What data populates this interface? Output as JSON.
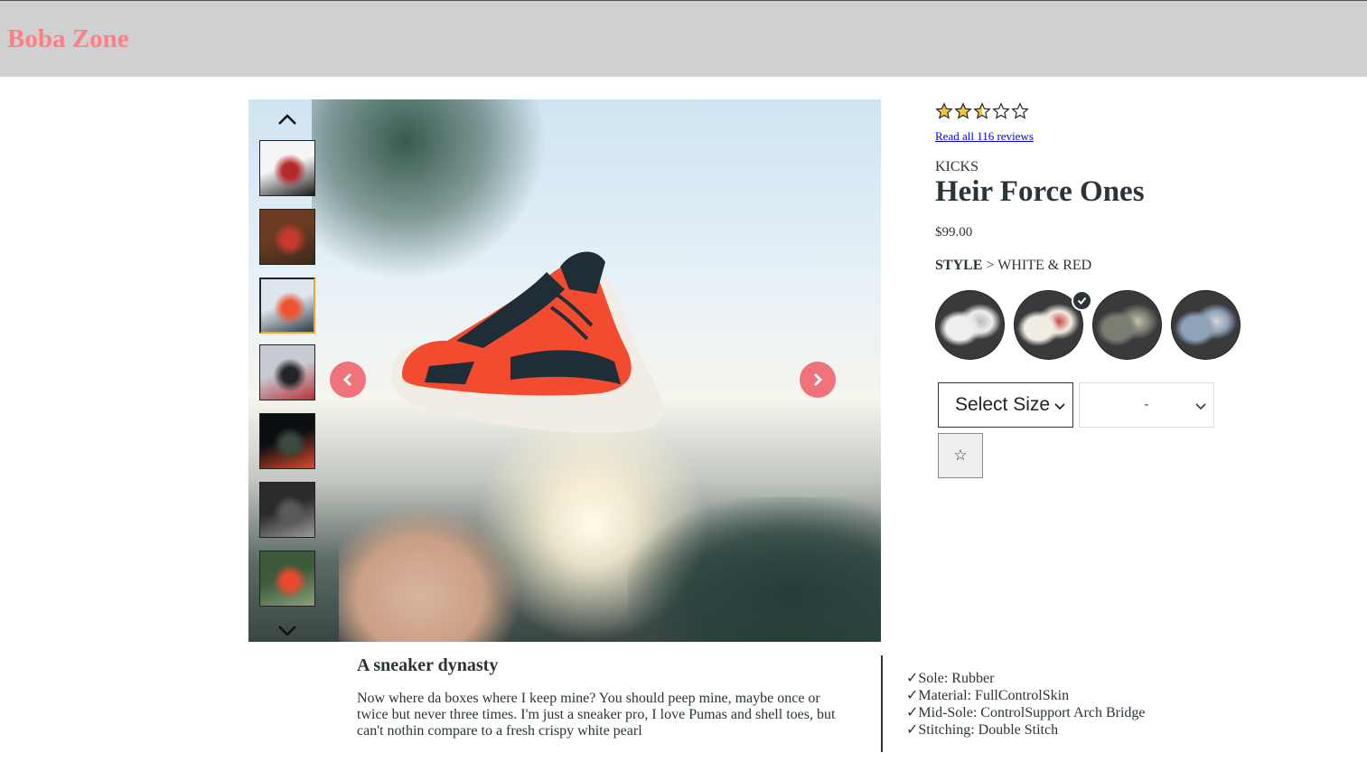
{
  "header": {
    "brand": "Boba Zone"
  },
  "gallery": {
    "thumbnails": [
      {
        "name": "thumb-1",
        "colors": [
          "#f5f5f5",
          "#b52a2a",
          "#1a1a1a"
        ]
      },
      {
        "name": "thumb-2",
        "colors": [
          "#6b3b22",
          "#c43a2e",
          "#3a2a1a"
        ]
      },
      {
        "name": "thumb-3",
        "colors": [
          "#dde6ee",
          "#f0532f",
          "#2d3b44"
        ]
      },
      {
        "name": "thumb-4",
        "colors": [
          "#c7ccd2",
          "#222427",
          "#b9323a"
        ]
      },
      {
        "name": "thumb-5",
        "colors": [
          "#0b0f12",
          "#3a4a3e",
          "#e14a2a"
        ]
      },
      {
        "name": "thumb-6",
        "colors": [
          "#2b2b2b",
          "#5a5a5a",
          "#9a9a9a"
        ]
      },
      {
        "name": "thumb-7",
        "colors": [
          "#3d5a3a",
          "#e84a2e",
          "#8aa07a"
        ]
      }
    ],
    "active_thumbnail": 2,
    "accent": "#f0727a"
  },
  "product": {
    "rating": 2.5,
    "rating_max": 5,
    "reviews_link": "Read all 116 reviews",
    "category": "KICKS",
    "name": "Heir Force Ones",
    "price": "$99.00",
    "style_label": "STYLE",
    "style_separator": ">",
    "style_value": "WHITE & RED",
    "styles": [
      {
        "name": "style-white",
        "colors": [
          "#eeeeee",
          "#bbbbbb"
        ]
      },
      {
        "name": "style-white-red",
        "colors": [
          "#f2ede4",
          "#c9433e"
        ]
      },
      {
        "name": "style-grey-camo",
        "colors": [
          "#7a7d72",
          "#c6c0a8"
        ]
      },
      {
        "name": "style-blue-grey",
        "colors": [
          "#8fa3b8",
          "#d7d7d7"
        ]
      }
    ],
    "selected_style": 1,
    "size_select": "Select Size",
    "quantity_select": "-",
    "favorite_icon": "☆"
  },
  "description": {
    "title": "A sneaker dynasty",
    "body": "Now where da boxes where I keep mine? You should peep mine, maybe once or twice but never three times. I'm just a sneaker pro, I love Pumas and shell toes, but can't nothin compare to a fresh crispy white pearl",
    "features": [
      "Sole: Rubber",
      "Material: FullControlSkin",
      "Mid-Sole: ControlSupport Arch Bridge",
      "Stitching: Double Stitch"
    ],
    "check_glyph": "✓"
  }
}
